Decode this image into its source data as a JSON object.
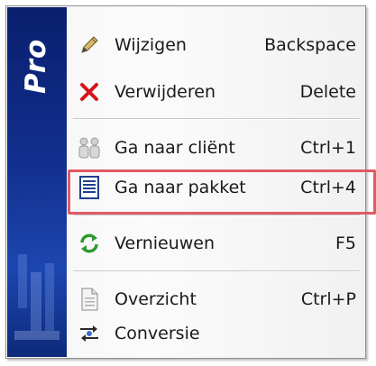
{
  "brand": {
    "text": "Pro",
    "color": "#12308f"
  },
  "menu": {
    "items": [
      {
        "label": "Wijzigen",
        "shortcut": "Backspace",
        "icon": "pencil-icon"
      },
      {
        "label": "Verwijderen",
        "shortcut": "Delete",
        "icon": "red-x-icon"
      },
      {
        "label": "Ga naar cliënt",
        "shortcut": "Ctrl+1",
        "icon": "people-icon"
      },
      {
        "label": "Ga naar pakket",
        "shortcut": "Ctrl+4",
        "icon": "document-list-icon"
      },
      {
        "label": "Vernieuwen",
        "shortcut": "F5",
        "icon": "refresh-icon"
      },
      {
        "label": "Overzicht",
        "shortcut": "Ctrl+P",
        "icon": "page-icon"
      },
      {
        "label": "Conversie",
        "shortcut": "",
        "icon": "conversion-icon"
      }
    ],
    "highlighted": "Ga naar pakket",
    "highlight_color": "#e05a64"
  }
}
